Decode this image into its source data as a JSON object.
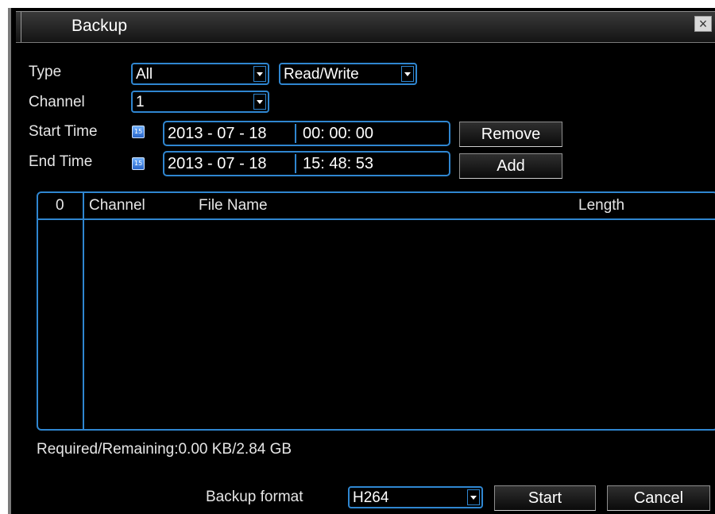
{
  "window": {
    "title": "Backup",
    "close_label": "×"
  },
  "type": {
    "label": "Type",
    "value": "All",
    "mode_value": "Read/Write"
  },
  "channel": {
    "label": "Channel",
    "value": "1"
  },
  "start_time": {
    "label": "Start Time",
    "date": "2013 - 07 - 18",
    "time": "00: 00: 00"
  },
  "end_time": {
    "label": "End Time",
    "date": "2013 - 07 - 18",
    "time": "15: 48: 53"
  },
  "buttons": {
    "remove": "Remove",
    "add": "Add",
    "start": "Start",
    "cancel": "Cancel"
  },
  "table": {
    "headers": {
      "index": "0",
      "channel": "Channel",
      "file_name": "File Name",
      "length": "Length"
    },
    "rows": []
  },
  "status": {
    "required_remaining": "Required/Remaining:0.00 KB/2.84 GB"
  },
  "backup_format": {
    "label": "Backup format",
    "value": "H264"
  },
  "colors": {
    "accent": "#2f86d0",
    "background": "#000000",
    "text": "#e6e6e6"
  },
  "icons": {
    "calendar": "calendar-icon",
    "dropdown": "chevron-down-icon",
    "close": "close-icon"
  }
}
